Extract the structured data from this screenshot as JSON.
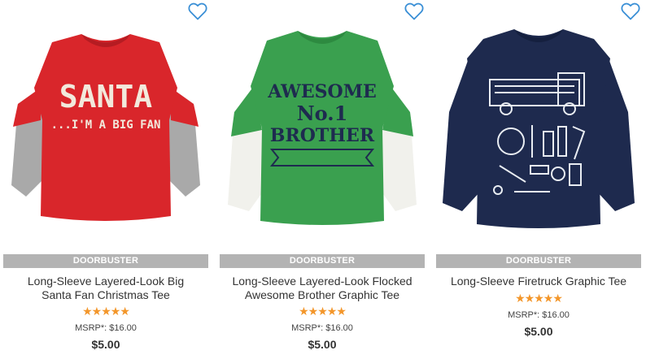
{
  "products": [
    {
      "badge": "DOORBUSTER",
      "title_line1": "Long-Sleeve Layered-Look Big",
      "title_line2": "Santa Fan Christmas Tee",
      "rating_stars": "★★★★★",
      "rating": 5,
      "msrp": "MSRP*: $16.00",
      "price": "$5.00",
      "shirt_text1": "SANTA",
      "shirt_text2": "...I'M A BIG FAN",
      "colors": {
        "body": "#d9262b",
        "sleeves": "#a8a8a8",
        "print": "#f2e9dc"
      }
    },
    {
      "badge": "DOORBUSTER",
      "title_line1": "Long-Sleeve Layered-Look Flocked",
      "title_line2": "Awesome Brother Graphic Tee",
      "rating_stars": "★★★★★",
      "rating": 5,
      "msrp": "MSRP*: $16.00",
      "price": "$5.00",
      "shirt_text1": "AWESOME",
      "shirt_text2": "No.1",
      "shirt_text3": "BROTHER",
      "colors": {
        "body": "#3aa04f",
        "sleeves": "#f1f1ec",
        "print": "#1e2b4f"
      }
    },
    {
      "badge": "DOORBUSTER",
      "title_line1": "Long-Sleeve Firetruck Graphic Tee",
      "rating_stars": "★★★★★",
      "rating": 5,
      "msrp": "MSRP*: $16.00",
      "price": "$5.00",
      "colors": {
        "body": "#1e2a4e",
        "sleeves": "#1e2a4e",
        "print": "#e9edf2"
      }
    }
  ],
  "icons": {
    "wishlist": "heart-outline-icon",
    "accent": "#3a8fd6",
    "star_color": "#f3962a"
  }
}
